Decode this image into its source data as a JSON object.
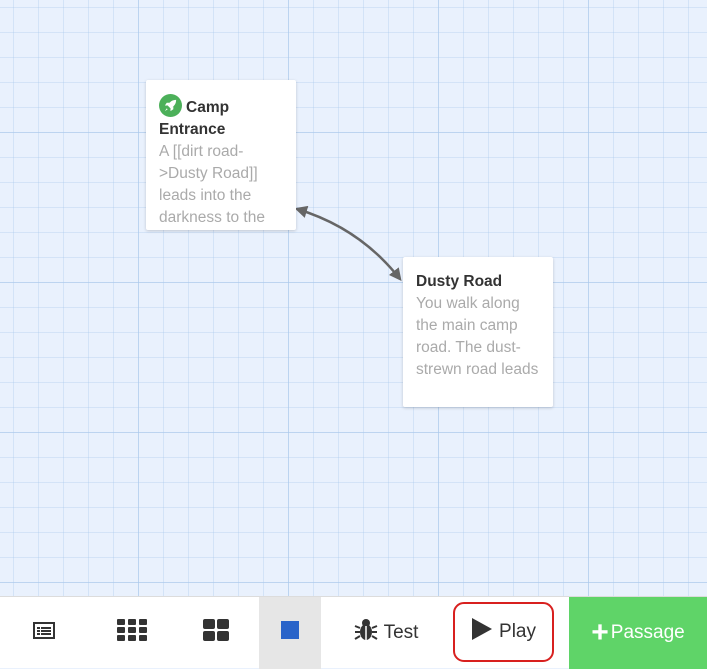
{
  "passages": [
    {
      "title_line1": "Camp",
      "title_line2": "Entrance",
      "is_start": true,
      "excerpt": "A [[dirt road->Dusty Road]] leads into the darkness to the"
    },
    {
      "title": "Dusty Road",
      "is_start": false,
      "excerpt": "You walk along the main camp road. The dust-strewn road leads back into"
    }
  ],
  "toolbar": {
    "story_details_icon": "story-details-icon",
    "zoom_small_icon": "grid-small-icon",
    "zoom_medium_icon": "grid-medium-icon",
    "zoom_large_icon": "square-icon",
    "test_label": "Test",
    "play_label": "Play",
    "passage_label": "Passage"
  },
  "colors": {
    "canvas_bg": "#e9f1fd",
    "start_icon": "#4cb05a",
    "zoom_active": "#2a64c9",
    "passage_button": "#5fd468",
    "play_highlight": "#d8201f"
  }
}
